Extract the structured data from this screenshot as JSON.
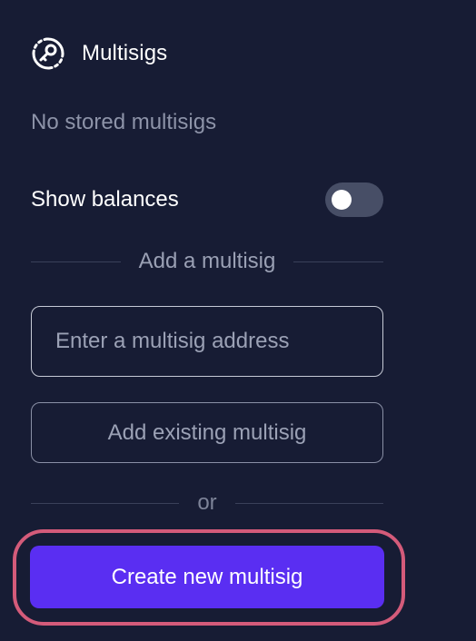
{
  "header": {
    "icon": "key-circle-icon",
    "title": "Multisigs"
  },
  "empty_state": {
    "text": "No stored multisigs"
  },
  "balances": {
    "label": "Show balances",
    "enabled": false
  },
  "add_section": {
    "divider_label": "Add a multisig",
    "address_placeholder": "Enter a multisig address",
    "address_value": "",
    "add_existing_label": "Add existing multisig"
  },
  "or_divider": {
    "label": "or"
  },
  "create": {
    "label": "Create new multisig"
  },
  "colors": {
    "background": "#171c34",
    "accent": "#5a2ef2",
    "highlight": "#d45b7a"
  }
}
